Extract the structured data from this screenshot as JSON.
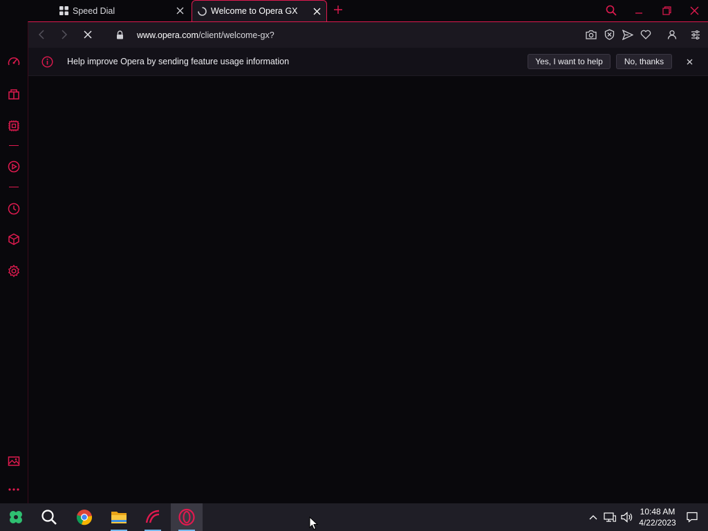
{
  "browser": {
    "name": "Opera GX",
    "accent": "#e01a4f"
  },
  "tabs": [
    {
      "title": "Speed Dial",
      "active": false,
      "icon": "speed-dial-grid-icon"
    },
    {
      "title": "Welcome to Opera GX",
      "active": true,
      "icon": "loading-spinner-icon"
    }
  ],
  "toolbar": {
    "url_host": "www.opera.com",
    "url_path": "/client/welcome-gx?"
  },
  "infobar": {
    "message": "Help improve Opera by sending feature usage information",
    "accept_label": "Yes, I want to help",
    "decline_label": "No, thanks"
  },
  "sidebar": {
    "items": [
      "gx-control-icon",
      "gx-store-icon",
      "gx-cpu-icon",
      "player-icon",
      "history-icon",
      "extensions-cube-icon",
      "settings-gear-icon",
      "snapshot-gallery-icon",
      "more-dots-icon"
    ]
  },
  "taskbar": {
    "apps": [
      "start-icon",
      "search-icon",
      "chrome-icon",
      "file-explorer-icon",
      "gx-corner-icon",
      "opera-gx-icon"
    ],
    "time": "10:48 AM",
    "date": "4/22/2023"
  }
}
